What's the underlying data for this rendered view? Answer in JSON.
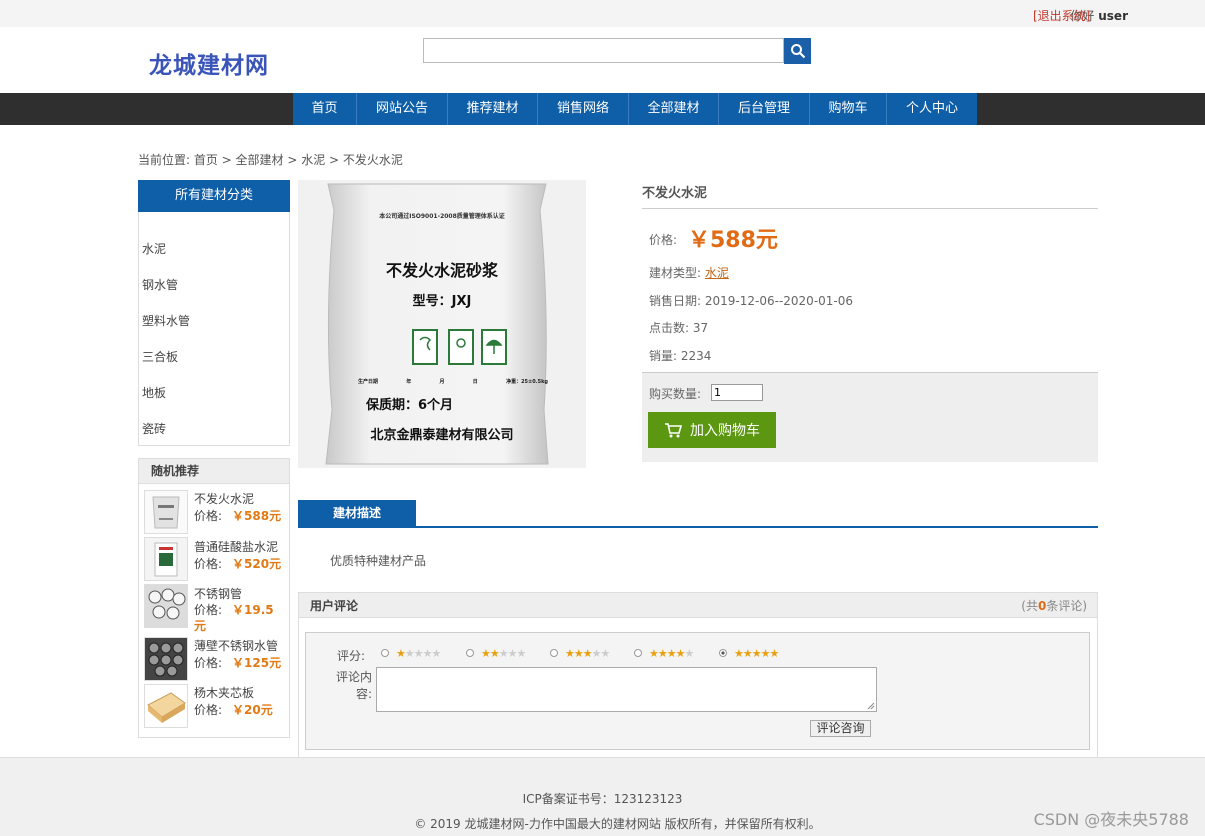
{
  "topbar": {
    "greeting": "你好",
    "username": "user",
    "logout": "[退出系统]"
  },
  "header": {
    "logo": "龙城建材网",
    "search_placeholder": ""
  },
  "nav": {
    "items": [
      "首页",
      "网站公告",
      "推荐建材",
      "销售网络",
      "全部建材",
      "后台管理",
      "购物车",
      "个人中心"
    ]
  },
  "breadcrumb": {
    "text": "当前位置: 首页 > 全部建材 > 水泥 > 不发火水泥"
  },
  "sidebar": {
    "categories_title": "所有建材分类",
    "categories": [
      "水泥",
      "钢水管",
      "塑料水管",
      "三合板",
      "地板",
      "瓷砖"
    ],
    "random_title": "随机推荐",
    "price_label": "价格:",
    "random_items": [
      {
        "name": "不发火水泥",
        "price": "￥588元"
      },
      {
        "name": "普通硅酸盐水泥",
        "price": "￥520元"
      },
      {
        "name": "不锈钢管",
        "price": "￥19.5元"
      },
      {
        "name": "薄壁不锈钢水管",
        "price": "￥125元"
      },
      {
        "name": "杨木夹芯板",
        "price": "￥20元"
      }
    ]
  },
  "product": {
    "image": {
      "cert_line": "本公司通过ISO9001-2008质量管理体系认证",
      "name": "不发火水泥砂浆",
      "model": "型号：JXJ",
      "meta": [
        "生产日期",
        "年",
        "月",
        "日",
        "净重：25±0.5kg"
      ],
      "shelf_life": "保质期：6个月",
      "company": "北京金鼎泰建材有限公司"
    },
    "title": "不发火水泥",
    "price_label": "价格:",
    "price": "￥588元",
    "type_label": "建材类型:",
    "type": "水泥",
    "sale_date_label": "销售日期:",
    "sale_date": "2019-12-06--2020-01-06",
    "clicks_label": "点击数:",
    "clicks": "37",
    "sales_label": "销量:",
    "sales": "2234",
    "qty_label": "购买数量:",
    "qty": "1",
    "add_to_cart": "加入购物车"
  },
  "description": {
    "tab": "建材描述",
    "text": "优质特种建材产品"
  },
  "comments": {
    "title": "用户评论",
    "count_prefix": "(共",
    "count": "0",
    "count_suffix": "条评论)",
    "rating_label": "评分:",
    "ratings": [
      1,
      2,
      3,
      4,
      5
    ],
    "selected_rating": 5,
    "content_label": "评论内容:",
    "submit": "评论咨询"
  },
  "footer": {
    "icp": "ICP备案证书号：123123123",
    "copyright": "© 2019 龙城建材网-力作中国最大的建材网站 版权所有，并保留所有权利。"
  },
  "watermark": "CSDN @夜未央5788",
  "colors": {
    "brand_blue": "#0f5ea8",
    "price_orange": "#e06b14",
    "cart_green": "#5c9711",
    "nav_dark": "#2f2f2f"
  }
}
